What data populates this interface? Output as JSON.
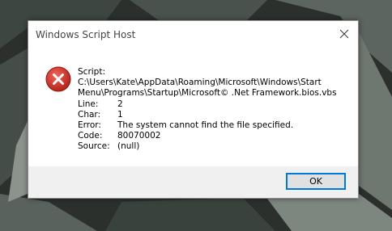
{
  "window": {
    "title": "Windows Script Host",
    "close_icon": "close-icon",
    "message_icon": "error-icon"
  },
  "message": {
    "script_label": "Script:",
    "script_path_line1": "C:\\Users\\Kate\\AppData\\Roaming\\Microsoft\\Windows\\Start",
    "script_path_line2": "Menu\\Programs\\Startup\\Microsoft© .Net Framework.bios.vbs",
    "fields": [
      {
        "label": "Line:",
        "value": "2"
      },
      {
        "label": "Char:",
        "value": "1"
      },
      {
        "label": "Error:",
        "value": "The system cannot find the file specified."
      },
      {
        "label": "Code:",
        "value": "80070002"
      },
      {
        "label": "Source:",
        "value": "(null)"
      }
    ]
  },
  "buttons": {
    "ok_label": "OK"
  },
  "colors": {
    "error_red": "#c42b1c",
    "button_border": "#0078d7"
  }
}
